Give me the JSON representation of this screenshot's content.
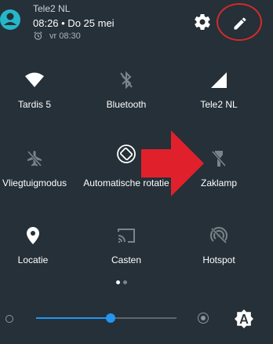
{
  "header": {
    "carrier": "Tele2 NL",
    "datetime": "08:26 • Do 25 mei",
    "alarm": "vr 08:30"
  },
  "tiles": [
    {
      "label": "Tardis 5",
      "icon": "wifi-icon"
    },
    {
      "label": "Bluetooth",
      "icon": "bluetooth-icon"
    },
    {
      "label": "Tele2 NL",
      "icon": "cellular-signal-icon"
    },
    {
      "label": "Vliegtuigmodus",
      "icon": "airplane-mode-icon"
    },
    {
      "label": "Automatische rotatie",
      "icon": "auto-rotate-icon"
    },
    {
      "label": "Zaklamp",
      "icon": "flashlight-icon"
    },
    {
      "label": "Locatie",
      "icon": "location-icon"
    },
    {
      "label": "Casten",
      "icon": "cast-icon"
    },
    {
      "label": "Hotspot",
      "icon": "hotspot-icon"
    }
  ],
  "page_indicator": {
    "current": 1,
    "total": 2
  },
  "brightness": {
    "level": 0.53
  },
  "colors": {
    "background": "#253038",
    "accent": "#2196f3",
    "active_icon": "#ffffff",
    "inactive_icon": "#7a858b",
    "annotation_red": "#e0212b"
  }
}
